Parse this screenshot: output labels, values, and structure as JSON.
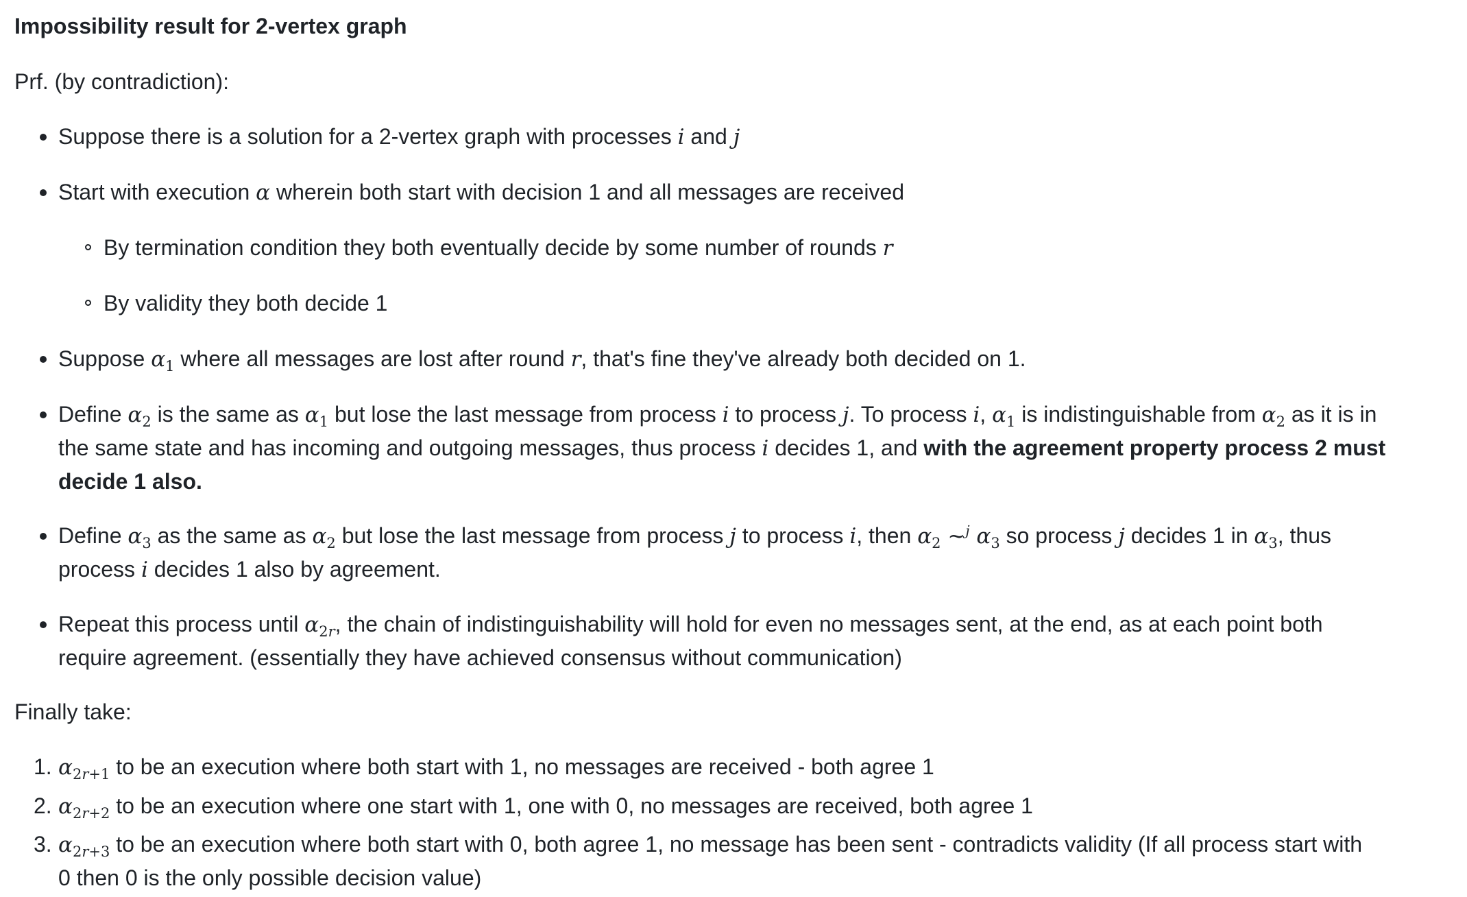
{
  "title": "Impossibility result for 2-vertex graph",
  "proof_intro": "Prf. (by contradiction):",
  "bullets": {
    "b1": {
      "pre": "Suppose there is a solution for a 2-vertex graph with processes ",
      "v1": "i",
      "mid": " and ",
      "v2": "j"
    },
    "b2": {
      "pre": "Start with execution ",
      "v1": "α",
      "post": " wherein both start with decision 1 and all messages are received"
    },
    "b2_sub1": {
      "pre": "By termination condition they both eventually decide by some number of rounds ",
      "v1": "r"
    },
    "b2_sub2": {
      "text": "By validity they both decide 1"
    },
    "b3": {
      "pre": "Suppose ",
      "v1": "α",
      "s1": "1",
      "mid": " where all messages are lost after round ",
      "v2": "r",
      "post": ", that's fine they've already both decided on 1."
    },
    "b4": {
      "t1": "Define ",
      "a2": "α",
      "a2s": "2",
      "t2": " is the same as ",
      "a1": "α",
      "a1s": "1",
      "t3": " but lose the last message from process ",
      "vi": "i",
      "t4": " to process ",
      "vj": "j",
      "t5": ". To process ",
      "vi2": "i",
      "t6": ", ",
      "a1b": "α",
      "a1bs": "1",
      "t7": " is indistinguishable from ",
      "a2b": "α",
      "a2bs": "2",
      "t8": " as it is in",
      "line2a": "the same state and has incoming and outgoing messages, thus process ",
      "vi3": "i",
      "line2b": " decides 1, and ",
      "bold1": "with the agreement property process 2 must",
      "bold2": "decide 1 also."
    },
    "b5": {
      "t1": "Define ",
      "a3": "α",
      "a3s": "3",
      "t2": " as the same as ",
      "a2": "α",
      "a2s": "2",
      "t3": " but lose the last message from process ",
      "vj": "j",
      "t4": " to process ",
      "vi": "i",
      "t5": ", then ",
      "a2b": "α",
      "a2bs": "2",
      "sim": " ~",
      "simsup": "j",
      "a3b": " α",
      "a3bs": "3",
      "t6": " so process ",
      "vj2": "j",
      "t7": " decides 1 in ",
      "a3c": "α",
      "a3cs": "3",
      "t8": ", thus",
      "line2a": "process ",
      "vi2": "i",
      "line2b": " decides 1 also by agreement."
    },
    "b6": {
      "t1": "Repeat this process until ",
      "a": "α",
      "as_pre": "2",
      "as_var": "r",
      "t2": ", the chain of indistinguishability will hold for even no messages sent, at the end, as at each point both",
      "line2": "require agreement. (essentially they have achieved consensus without communication)"
    }
  },
  "finally": "Finally take:",
  "numbered": [
    {
      "num": "1.",
      "a": "α",
      "sub_pre": "2",
      "sub_var": "r",
      "sub_post": "+1",
      "text": " to be an execution where both start with 1, no messages are received - both agree 1"
    },
    {
      "num": "2.",
      "a": "α",
      "sub_pre": "2",
      "sub_var": "r",
      "sub_post": "+2",
      "text": " to be an execution where one start with 1, one with 0, no messages are received, both agree 1"
    },
    {
      "num": "3.",
      "a": "α",
      "sub_pre": "2",
      "sub_var": "r",
      "sub_post": "+3",
      "text": " to be an execution where both start with 0, both agree 1, no message has been sent - contradicts validity (If all process start with",
      "line2": "0 then 0 is the only possible decision value)"
    }
  ]
}
